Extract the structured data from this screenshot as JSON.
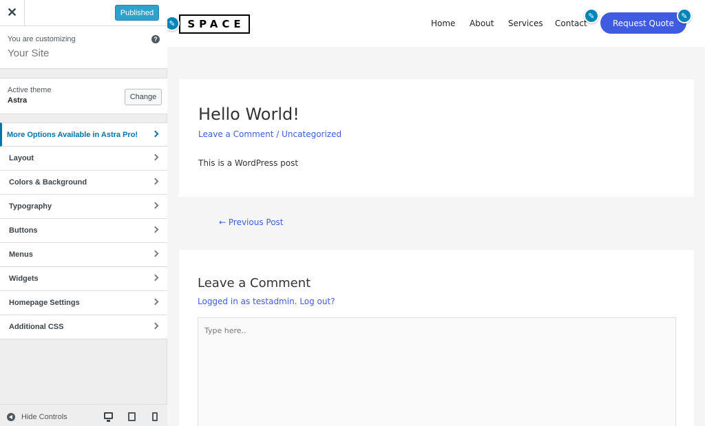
{
  "sidebar": {
    "close_label": "✕",
    "publish_label": "Published",
    "info": {
      "label": "You are customizing",
      "title": "Your Site",
      "help_label": "?"
    },
    "theme": {
      "label": "Active theme",
      "name": "Astra",
      "change_label": "Change"
    },
    "items": [
      {
        "label": "More Options Available in Astra Pro!"
      },
      {
        "label": "Layout"
      },
      {
        "label": "Colors & Background"
      },
      {
        "label": "Typography"
      },
      {
        "label": "Buttons"
      },
      {
        "label": "Menus"
      },
      {
        "label": "Widgets"
      },
      {
        "label": "Homepage Settings"
      },
      {
        "label": "Additional CSS"
      }
    ],
    "footer": {
      "hide_label": "Hide Controls"
    }
  },
  "site": {
    "logo": "SPACE",
    "nav": [
      "Home",
      "About",
      "Services",
      "Contact"
    ],
    "cta_label": "Request Quote"
  },
  "post": {
    "title": "Hello World!",
    "meta": "Leave a Comment / Uncategorized",
    "body": "This is a WordPress post",
    "prev_label": "← Previous Post"
  },
  "comments": {
    "title": "Leave a Comment",
    "logged_in": "Logged in as testadmin. Log out?",
    "placeholder": "Type here.."
  },
  "colors": {
    "accent": "#3f5ce0",
    "customizer_blue": "#0073aa",
    "publish_button": "#2ea2cc"
  },
  "icons": [
    "close-icon",
    "help-icon",
    "chevron-right-icon",
    "hide-controls-icon",
    "desktop-icon",
    "tablet-icon",
    "mobile-icon",
    "pencil-icon"
  ]
}
